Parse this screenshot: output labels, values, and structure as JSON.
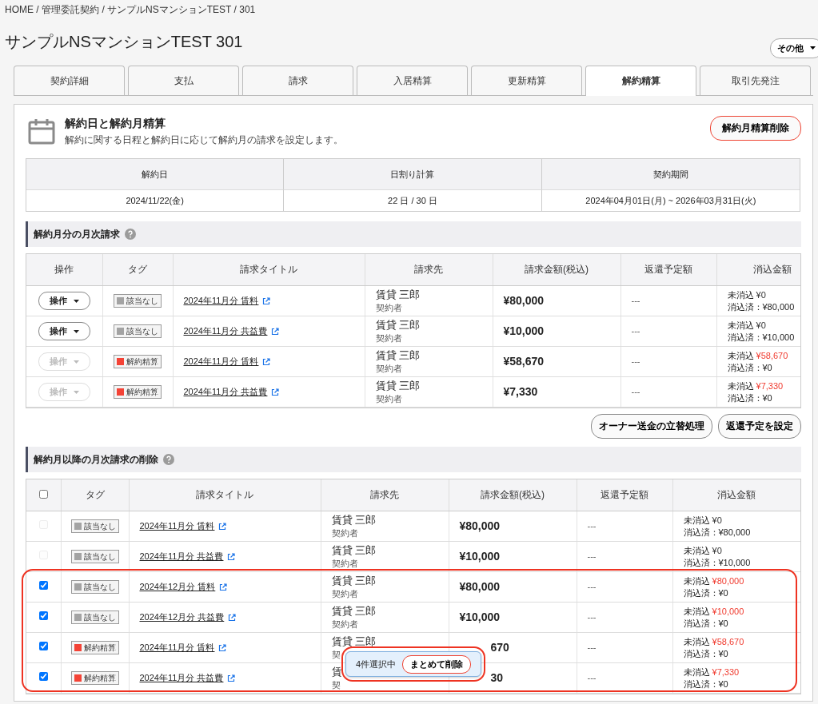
{
  "breadcrumb": [
    "HOME",
    "管理委託契約",
    "サンプルNSマンションTEST",
    "301"
  ],
  "breadcrumb_separator": "/",
  "title": "サンプルNSマンションTEST 301",
  "more_button": "その他",
  "tabs": [
    {
      "label": "契約詳細",
      "selected": false
    },
    {
      "label": "支払",
      "selected": false
    },
    {
      "label": "請求",
      "selected": false
    },
    {
      "label": "入居精算",
      "selected": false
    },
    {
      "label": "更新精算",
      "selected": false
    },
    {
      "label": "解約精算",
      "selected": true
    },
    {
      "label": "取引先発注",
      "selected": false
    }
  ],
  "card": {
    "heading": "解約日と解約月精算",
    "description": "解約に関する日程と解約日に応じて解約月の請求を設定します。",
    "delete_button": "解約月精算削除",
    "summary": [
      {
        "label": "解約日",
        "value": "2024/11/22(金)"
      },
      {
        "label": "日割り計算",
        "value": "22 日 / 30 日"
      },
      {
        "label": "契約期間",
        "value": "2024年04月01日(月) ~ 2026年03月31日(火)"
      }
    ]
  },
  "section_1": {
    "heading": "解約月分の月次請求",
    "columns": [
      "操作",
      "タグ",
      "請求タイトル",
      "請求先",
      "請求金額(税込)",
      "返還予定額",
      "消込金額"
    ],
    "rows": [
      {
        "action": "操作",
        "action_disabled": false,
        "tag": "該当なし",
        "color": "#a3a3a3",
        "title": "2024年11月分 賃料",
        "payer": "賃貸 三郎",
        "role": "契約者",
        "amount": "¥80,000",
        "refund": "---",
        "unpaid_label": "未消込",
        "unpaid": "¥0",
        "outstanding": false,
        "paid": "消込済：¥80,000"
      },
      {
        "action": "操作",
        "action_disabled": false,
        "tag": "該当なし",
        "color": "#a3a3a3",
        "title": "2024年11月分 共益費",
        "payer": "賃貸 三郎",
        "role": "契約者",
        "amount": "¥10,000",
        "refund": "---",
        "unpaid_label": "未消込",
        "unpaid": "¥0",
        "outstanding": false,
        "paid": "消込済：¥10,000"
      },
      {
        "action": "操作",
        "action_disabled": true,
        "tag": "解約精算",
        "color": "#f44336",
        "title": "2024年11月分 賃料",
        "payer": "賃貸 三郎",
        "role": "契約者",
        "amount": "¥58,670",
        "refund": "---",
        "unpaid_label": "未消込",
        "unpaid": "¥58,670",
        "outstanding": true,
        "paid": "消込済：¥0"
      },
      {
        "action": "操作",
        "action_disabled": true,
        "tag": "解約精算",
        "color": "#f44336",
        "title": "2024年11月分 共益費",
        "payer": "賃貸 三郎",
        "role": "契約者",
        "amount": "¥7,330",
        "refund": "---",
        "unpaid_label": "未消込",
        "unpaid": "¥7,330",
        "outstanding": true,
        "paid": "消込済：¥0"
      }
    ],
    "buttons": [
      "オーナー送金の立替処理",
      "返還予定を設定"
    ]
  },
  "section_2": {
    "heading": "解約月以降の月次請求の削除",
    "select_all_checked": false,
    "columns": [
      "タグ",
      "請求タイトル",
      "請求先",
      "請求金額(税込)",
      "返還予定額",
      "消込金額"
    ],
    "rows": [
      {
        "checked": false,
        "disabled": true,
        "highlighted": false,
        "tag": "該当なし",
        "color": "#a3a3a3",
        "title": "2024年11月分 賃料",
        "payer": "賃貸 三郎",
        "role": "契約者",
        "amount": "¥80,000",
        "refund": "---",
        "unpaid_label": "未消込",
        "unpaid": "¥0",
        "outstanding": false,
        "paid": "消込済：¥80,000"
      },
      {
        "checked": false,
        "disabled": true,
        "highlighted": false,
        "tag": "該当なし",
        "color": "#a3a3a3",
        "title": "2024年11月分 共益費",
        "payer": "賃貸 三郎",
        "role": "契約者",
        "amount": "¥10,000",
        "refund": "---",
        "unpaid_label": "未消込",
        "unpaid": "¥0",
        "outstanding": false,
        "paid": "消込済：¥10,000"
      },
      {
        "checked": true,
        "disabled": false,
        "highlighted": true,
        "tag": "該当なし",
        "color": "#a3a3a3",
        "title": "2024年12月分 賃料",
        "payer": "賃貸 三郎",
        "role": "契約者",
        "amount": "¥80,000",
        "refund": "---",
        "unpaid_label": "未消込",
        "unpaid": "¥80,000",
        "outstanding": true,
        "paid": "消込済：¥0"
      },
      {
        "checked": true,
        "disabled": false,
        "highlighted": true,
        "tag": "該当なし",
        "color": "#a3a3a3",
        "title": "2024年12月分 共益費",
        "payer": "賃貸 三郎",
        "role": "契約者",
        "amount": "¥10,000",
        "refund": "---",
        "unpaid_label": "未消込",
        "unpaid": "¥10,000",
        "outstanding": true,
        "paid": "消込済：¥0"
      },
      {
        "checked": true,
        "disabled": false,
        "highlighted": true,
        "tag": "解約精算",
        "color": "#f44336",
        "title": "2024年11月分 賃料",
        "payer": "賃貸 三郎",
        "role": "契",
        "amount": "670",
        "refund": "---",
        "unpaid_label": "未消込",
        "unpaid": "¥58,670",
        "outstanding": true,
        "paid": "消込済：¥0"
      },
      {
        "checked": true,
        "disabled": false,
        "highlighted": true,
        "tag": "解約精算",
        "color": "#f44336",
        "title": "2024年11月分 共益費",
        "payer": "賃",
        "role": "契",
        "amount": "30",
        "refund": "---",
        "unpaid_label": "未消込",
        "unpaid": "¥7,330",
        "outstanding": true,
        "paid": "消込済：¥0"
      }
    ],
    "selection_popup": {
      "count": "4件選択中",
      "button": "まとめて削除",
      "highlighted": true
    }
  }
}
